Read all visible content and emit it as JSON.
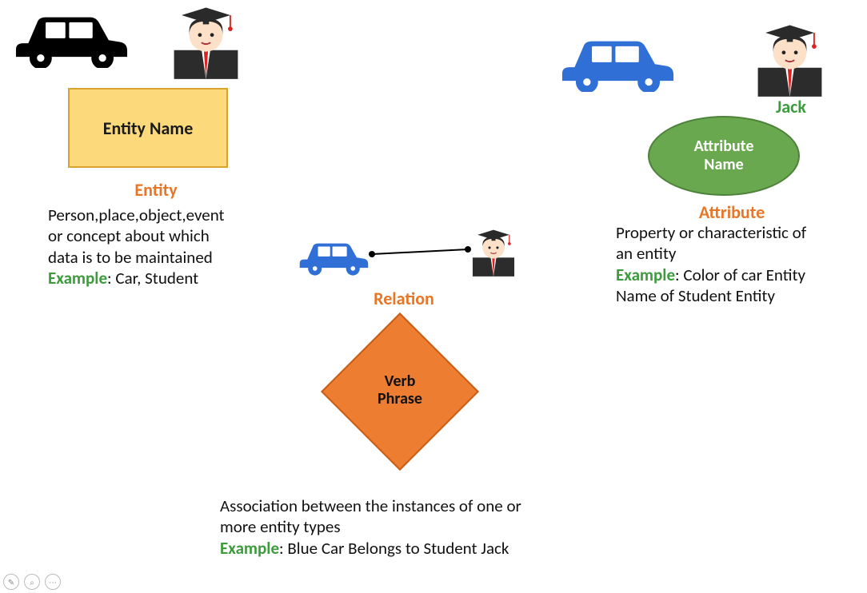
{
  "entity": {
    "box_label": "Entity Name",
    "title": "Entity",
    "description_line1": "Person,place,object,event",
    "description_line2": "or concept about which",
    "description_line3": "data is to be maintained",
    "example_label": "Example",
    "example_text": ": Car, Student"
  },
  "attribute": {
    "jack_label": "Jack",
    "ellipse_label_l1": "Attribute",
    "ellipse_label_l2": "Name",
    "title": "Attribute",
    "description_line1": "Property or characteristic of",
    "description_line2": "an entity",
    "example_label": "Example",
    "example_text_l1": ": Color of car Entity",
    "example_text_l2": "Name of Student Entity"
  },
  "relation": {
    "title": "Relation",
    "diamond_label_l1": "Verb",
    "diamond_label_l2": "Phrase",
    "description_line1": "Association between the instances of one or",
    "description_line2": "more entity types",
    "example_label": "Example",
    "example_text": ": Blue Car Belongs to Student Jack"
  },
  "colors": {
    "orange": "#e87626",
    "green_text": "#3d9b3d",
    "entity_fill": "#fcd97a",
    "attribute_fill": "#6aa84f",
    "relation_fill": "#ec7d31",
    "car_blue": "#2f6fd6",
    "car_black": "#000000"
  }
}
